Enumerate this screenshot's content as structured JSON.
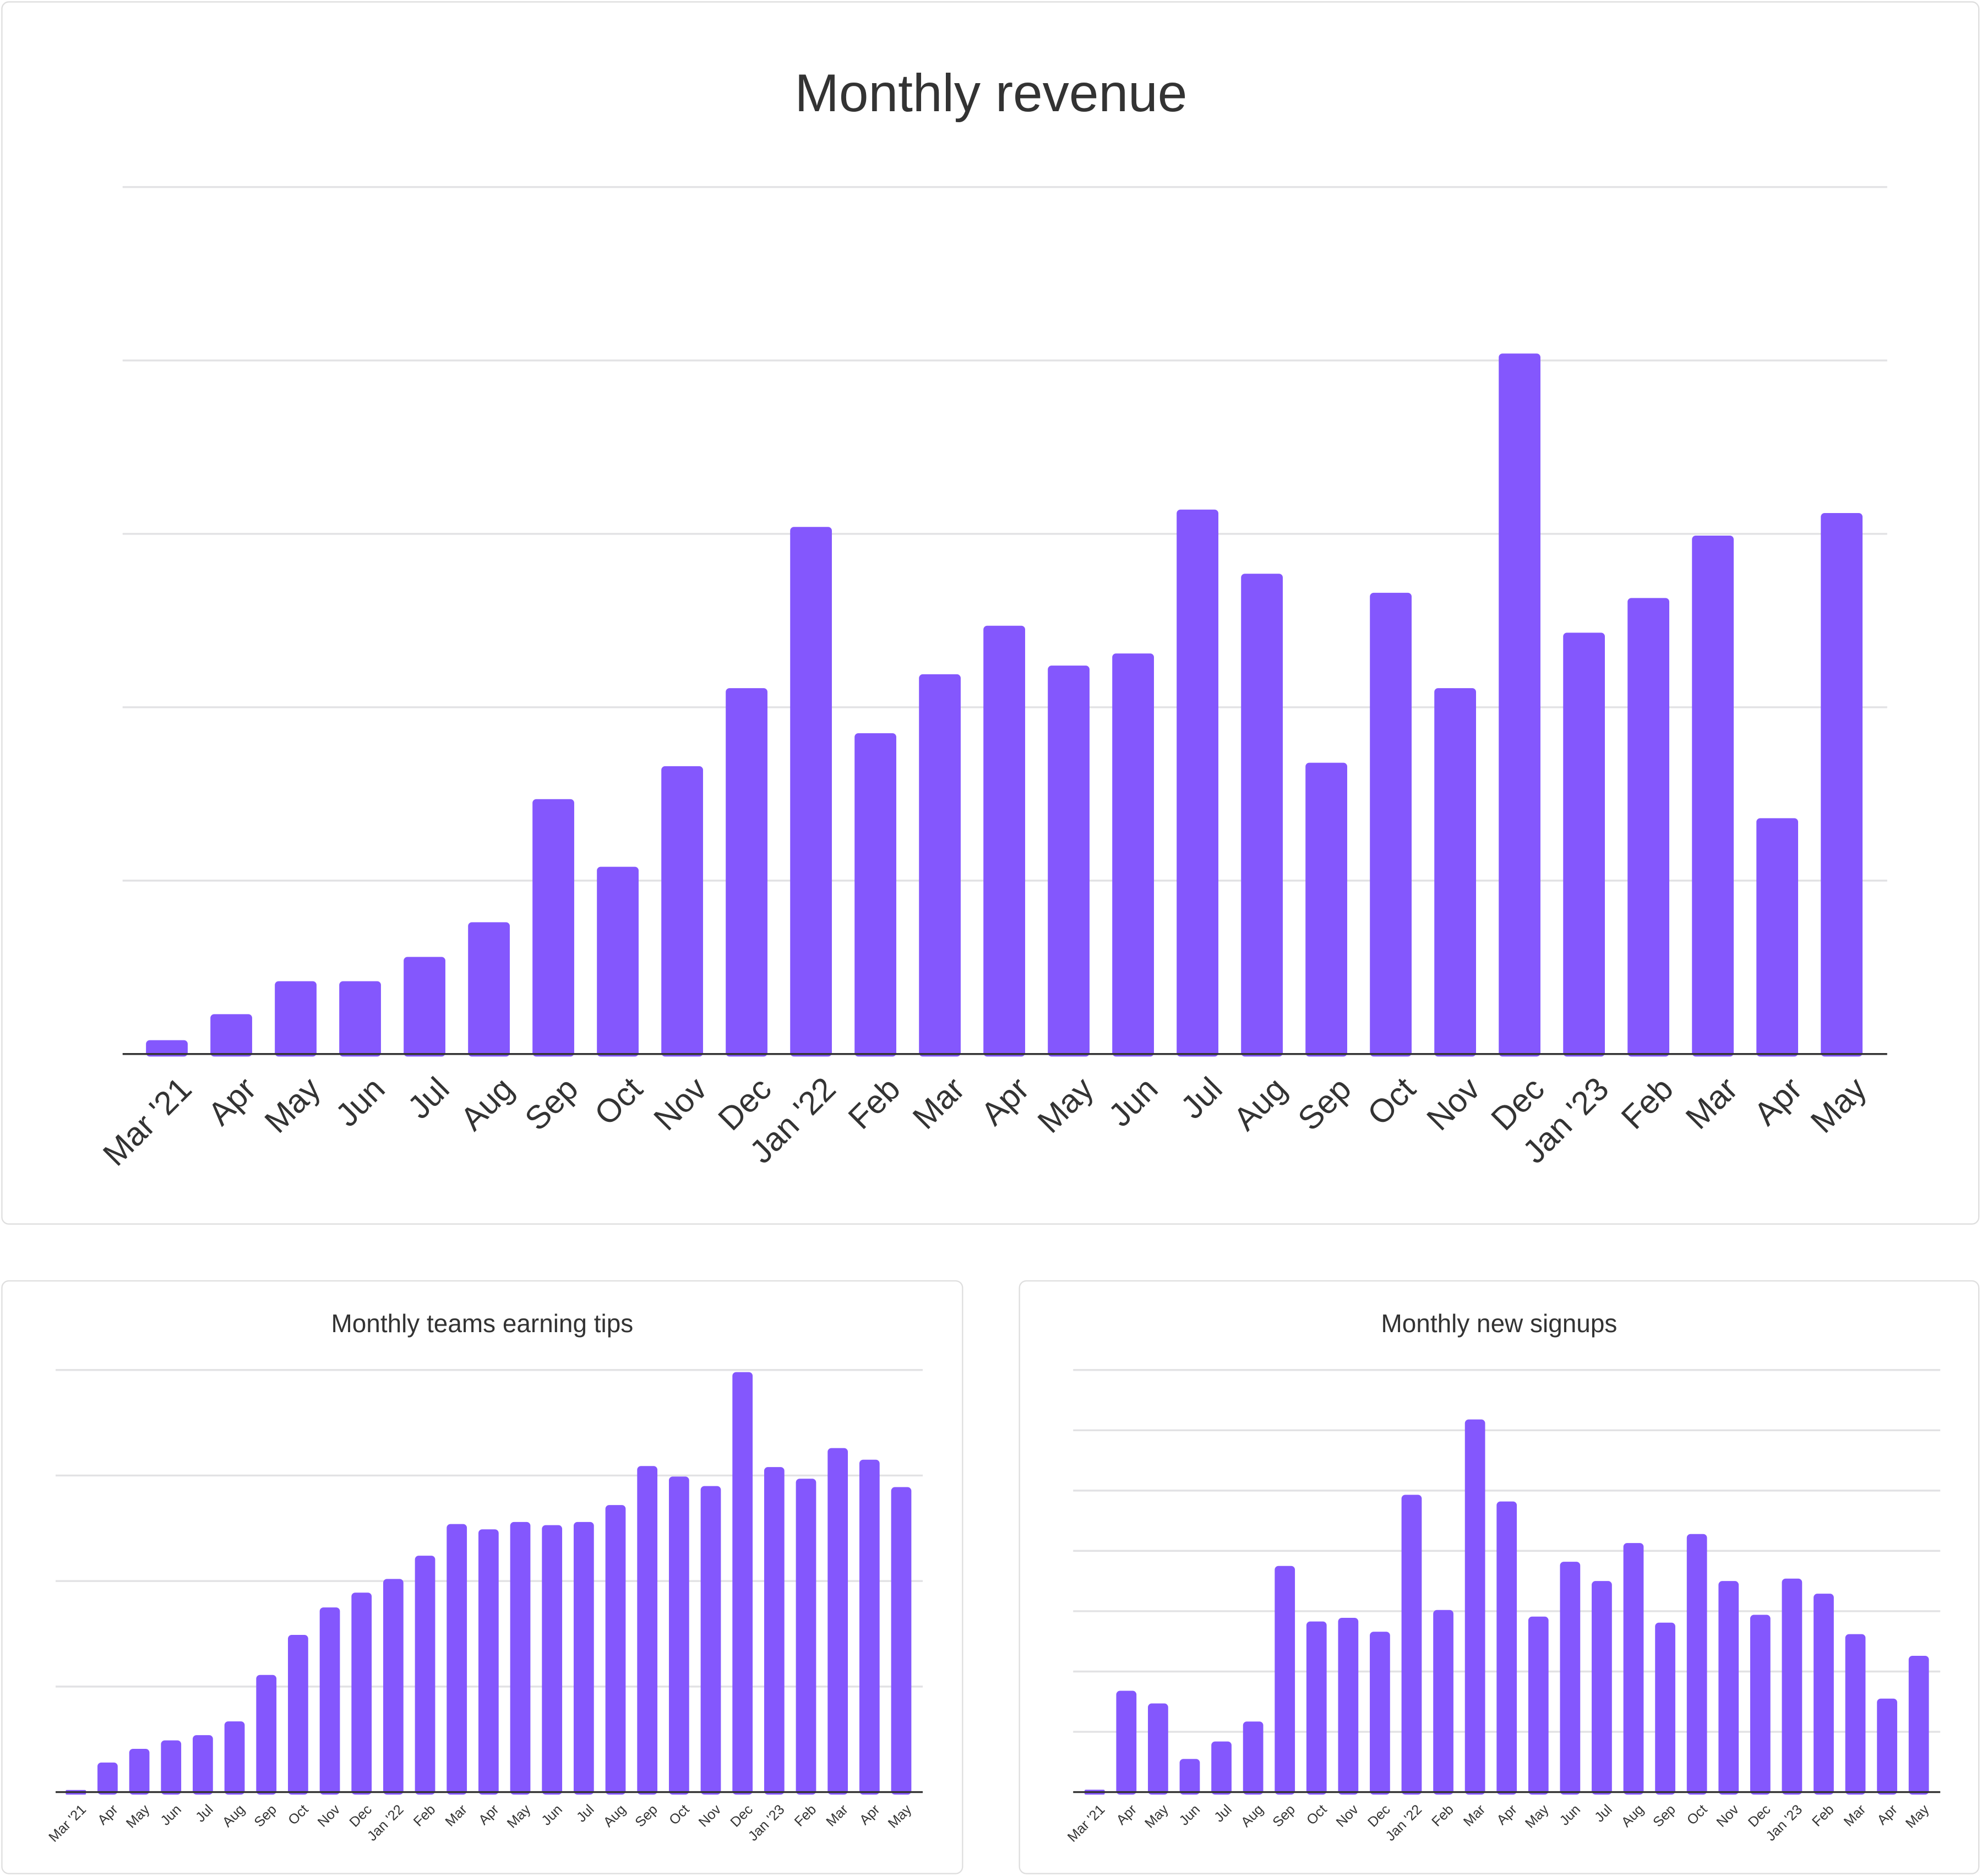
{
  "colors": {
    "bar": "#8457fd",
    "grid": "#e2e2e4",
    "axis": "#333333",
    "text": "#333333"
  },
  "chart_data": [
    {
      "type": "bar",
      "title": "Monthly revenue",
      "xlabel": "",
      "ylabel": "",
      "y_axis_labels_shown": false,
      "grid": true,
      "ylim": [
        0,
        5
      ],
      "categories": [
        "Mar '21",
        "Apr",
        "May",
        "Jun",
        "Jul",
        "Aug",
        "Sep",
        "Oct",
        "Nov",
        "Dec",
        "Jan '22",
        "Feb",
        "Mar",
        "Apr",
        "May",
        "Jun",
        "Jul",
        "Aug",
        "Sep",
        "Oct",
        "Nov",
        "Dec",
        "Jan '23",
        "Feb",
        "Mar",
        "Apr",
        "May"
      ],
      "values": [
        0.08,
        0.23,
        0.42,
        0.42,
        0.56,
        0.76,
        1.47,
        1.08,
        1.66,
        2.11,
        3.04,
        1.85,
        2.19,
        2.47,
        2.24,
        2.31,
        3.14,
        2.77,
        1.68,
        2.66,
        2.11,
        4.04,
        2.43,
        2.63,
        2.99,
        1.36,
        3.12
      ]
    },
    {
      "type": "bar",
      "title": "Monthly teams earning tips",
      "xlabel": "",
      "ylabel": "",
      "y_axis_labels_shown": false,
      "grid": true,
      "ylim": [
        0,
        4
      ],
      "categories": [
        "Mar '21",
        "Apr",
        "May",
        "Jun",
        "Jul",
        "Aug",
        "Sep",
        "Oct",
        "Nov",
        "Dec",
        "Jan '22",
        "Feb",
        "Mar",
        "Apr",
        "May",
        "Jun",
        "Jul",
        "Aug",
        "Sep",
        "Oct",
        "Nov",
        "Dec",
        "Jan '23",
        "Feb",
        "Mar",
        "Apr",
        "May"
      ],
      "values": [
        0.02,
        0.28,
        0.41,
        0.49,
        0.54,
        0.67,
        1.11,
        1.49,
        1.75,
        1.89,
        2.02,
        2.24,
        2.54,
        2.49,
        2.56,
        2.53,
        2.56,
        2.72,
        3.09,
        2.99,
        2.9,
        3.98,
        3.08,
        2.97,
        3.26,
        3.15,
        2.89
      ]
    },
    {
      "type": "bar",
      "title": "Monthly new signups",
      "xlabel": "",
      "ylabel": "",
      "y_axis_labels_shown": false,
      "grid": true,
      "ylim": [
        0,
        7
      ],
      "categories": [
        "Mar '21",
        "Apr",
        "May",
        "Jun",
        "Jul",
        "Aug",
        "Sep",
        "Oct",
        "Nov",
        "Dec",
        "Jan '22",
        "Feb",
        "Mar",
        "Apr",
        "May",
        "Jun",
        "Jul",
        "Aug",
        "Sep",
        "Oct",
        "Nov",
        "Dec",
        "Jan '23",
        "Feb",
        "Mar",
        "Apr",
        "May"
      ],
      "values": [
        0.04,
        1.68,
        1.47,
        0.55,
        0.84,
        1.17,
        3.75,
        2.83,
        2.89,
        2.66,
        4.93,
        3.02,
        6.18,
        4.82,
        2.91,
        3.82,
        3.5,
        4.13,
        2.81,
        4.28,
        3.5,
        2.94,
        3.54,
        3.29,
        2.62,
        1.55,
        2.26
      ]
    }
  ]
}
